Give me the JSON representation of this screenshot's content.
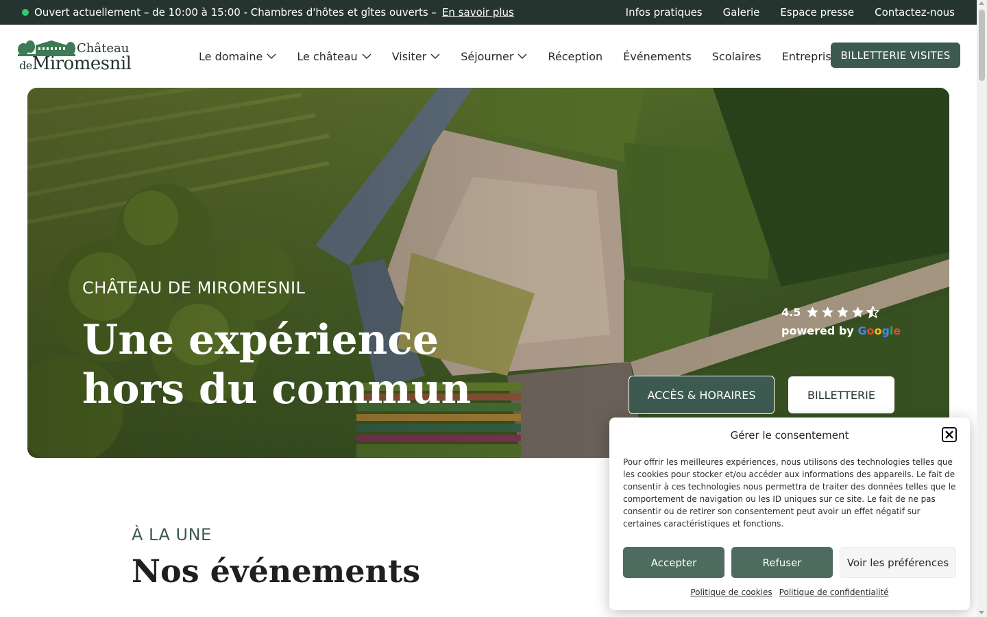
{
  "announcement": {
    "text": "Ouvert actuellement – de 10:00 à 15:00 - Chambres d'hôtes et gîtes ouverts –",
    "link": "En savoir plus",
    "status_color": "#2ecc71"
  },
  "top_links": [
    "Infos pratiques",
    "Galerie",
    "Espace presse",
    "Contactez-nous"
  ],
  "logo": {
    "line1": "Château",
    "line2_prefix": "de",
    "line2": "Miromesnil"
  },
  "nav": {
    "items": [
      {
        "label": "Le domaine",
        "has_dropdown": true
      },
      {
        "label": "Le château",
        "has_dropdown": true
      },
      {
        "label": "Visiter",
        "has_dropdown": true
      },
      {
        "label": "Séjourner",
        "has_dropdown": true
      },
      {
        "label": "Réception",
        "has_dropdown": false
      },
      {
        "label": "Événements",
        "has_dropdown": false
      },
      {
        "label": "Scolaires",
        "has_dropdown": false
      },
      {
        "label": "Entreprises",
        "has_dropdown": false
      }
    ],
    "cta": "BILLETTERIE VISITES"
  },
  "hero": {
    "eyebrow": "CHÂTEAU DE MIROMESNIL",
    "title_line1": "Une expérience",
    "title_line2": "hors du commun",
    "rating": {
      "score": "4.5",
      "stars": 4.5,
      "powered_by": "powered by",
      "provider": "Google"
    },
    "btn_access": "ACCÈS & HORAIRES",
    "btn_ticket": "BILLETTERIE"
  },
  "events": {
    "eyebrow": "À LA UNE",
    "title": "Nos événements"
  },
  "consent": {
    "title": "Gérer le consentement",
    "body": "Pour offrir les meilleures expériences, nous utilisons des technologies telles que les cookies pour stocker et/ou accéder aux informations des appareils. Le fait de consentir à ces technologies nous permettra de traiter des données telles que le comportement de navigation ou les ID uniques sur ce site. Le fait de ne pas consentir ou de retirer son consentement peut avoir un effet négatif sur certaines caractéristiques et fonctions.",
    "accept": "Accepter",
    "refuse": "Refuser",
    "preferences": "Voir les préférences",
    "cookie_policy": "Politique de cookies",
    "privacy_policy": "Politique de confidentialité"
  },
  "colors": {
    "dark_green": "#26342f",
    "brand_green": "#3d5a50",
    "button_green": "#4d6b5e"
  }
}
